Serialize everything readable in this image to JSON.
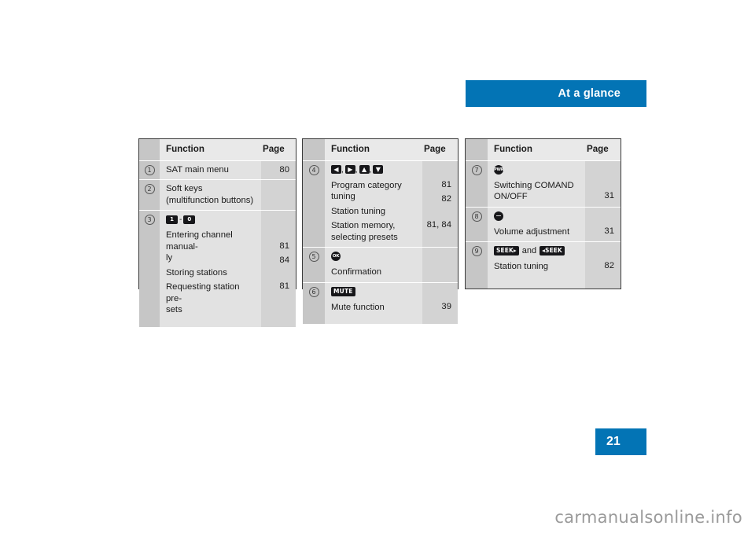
{
  "header": {
    "title": "At a glance",
    "accent_color": "#0374b5"
  },
  "page_number": "21",
  "watermark": "carmanualsonline.info",
  "tables": [
    {
      "id": "table-left",
      "columns": {
        "function": "Function",
        "page": "Page"
      },
      "rows": [
        {
          "marker": "1",
          "lines": [
            {
              "text": "SAT main menu",
              "page": "80"
            }
          ]
        },
        {
          "marker": "2",
          "lines": [
            {
              "text": "Soft keys",
              "page": ""
            },
            {
              "text": "(multifunction buttons)",
              "page": ""
            }
          ]
        },
        {
          "marker": "3",
          "glyphs": [
            {
              "type": "key-number",
              "label": "1"
            },
            {
              "type": "separator",
              "label": "-"
            },
            {
              "type": "key-number",
              "label": "0",
              "sub": "␣"
            }
          ],
          "lines": [
            {
              "text": "Entering channel manual-",
              "page": ""
            },
            {
              "text": "ly",
              "page": "81"
            },
            {
              "text": "Storing stations",
              "page": "84"
            },
            {
              "text": "Requesting station pre-",
              "page": ""
            },
            {
              "text": "sets",
              "page": "81"
            }
          ]
        }
      ]
    },
    {
      "id": "table-middle",
      "columns": {
        "function": "Function",
        "page": "Page"
      },
      "rows": [
        {
          "marker": "4",
          "glyphs": [
            {
              "type": "key-arrow",
              "label": "◀"
            },
            {
              "type": "comma",
              "label": ","
            },
            {
              "type": "key-arrow",
              "label": "▶"
            },
            {
              "type": "comma",
              "label": ","
            },
            {
              "type": "key-arrow",
              "label": "▲"
            },
            {
              "type": "comma",
              "label": ","
            },
            {
              "type": "key-arrow",
              "label": "▼"
            }
          ],
          "lines": [
            {
              "text": "Program category tuning",
              "page": "81"
            },
            {
              "text": "Station tuning",
              "page": "82"
            },
            {
              "text": "Station memory,",
              "page": ""
            },
            {
              "text": "selecting presets",
              "page": "81, 84"
            }
          ]
        },
        {
          "marker": "5",
          "glyphs": [
            {
              "type": "circle-button",
              "label": "OK"
            }
          ],
          "lines": [
            {
              "text": "Confirmation",
              "page": ""
            }
          ]
        },
        {
          "marker": "6",
          "glyphs": [
            {
              "type": "key-label",
              "label": "MUTE"
            }
          ],
          "lines": [
            {
              "text": "Mute function",
              "page": "39"
            }
          ]
        }
      ]
    },
    {
      "id": "table-right",
      "columns": {
        "function": "Function",
        "page": "Page"
      },
      "rows": [
        {
          "marker": "7",
          "glyphs": [
            {
              "type": "circle-button",
              "label": "PWR"
            }
          ],
          "lines": [
            {
              "text": "Switching COMAND",
              "page": ""
            },
            {
              "text": "ON/OFF",
              "page": "31"
            }
          ]
        },
        {
          "marker": "8",
          "glyphs": [
            {
              "type": "circle-volume",
              "label": ""
            }
          ],
          "lines": [
            {
              "text": "Volume adjustment",
              "page": "31"
            }
          ]
        },
        {
          "marker": "9",
          "glyphs": [
            {
              "type": "key-label",
              "label": "SEEK▸"
            },
            {
              "type": "and",
              "label": "and"
            },
            {
              "type": "key-label",
              "label": "◂SEEK"
            }
          ],
          "lines": [
            {
              "text": "Station tuning",
              "page": "82"
            }
          ]
        }
      ]
    }
  ]
}
